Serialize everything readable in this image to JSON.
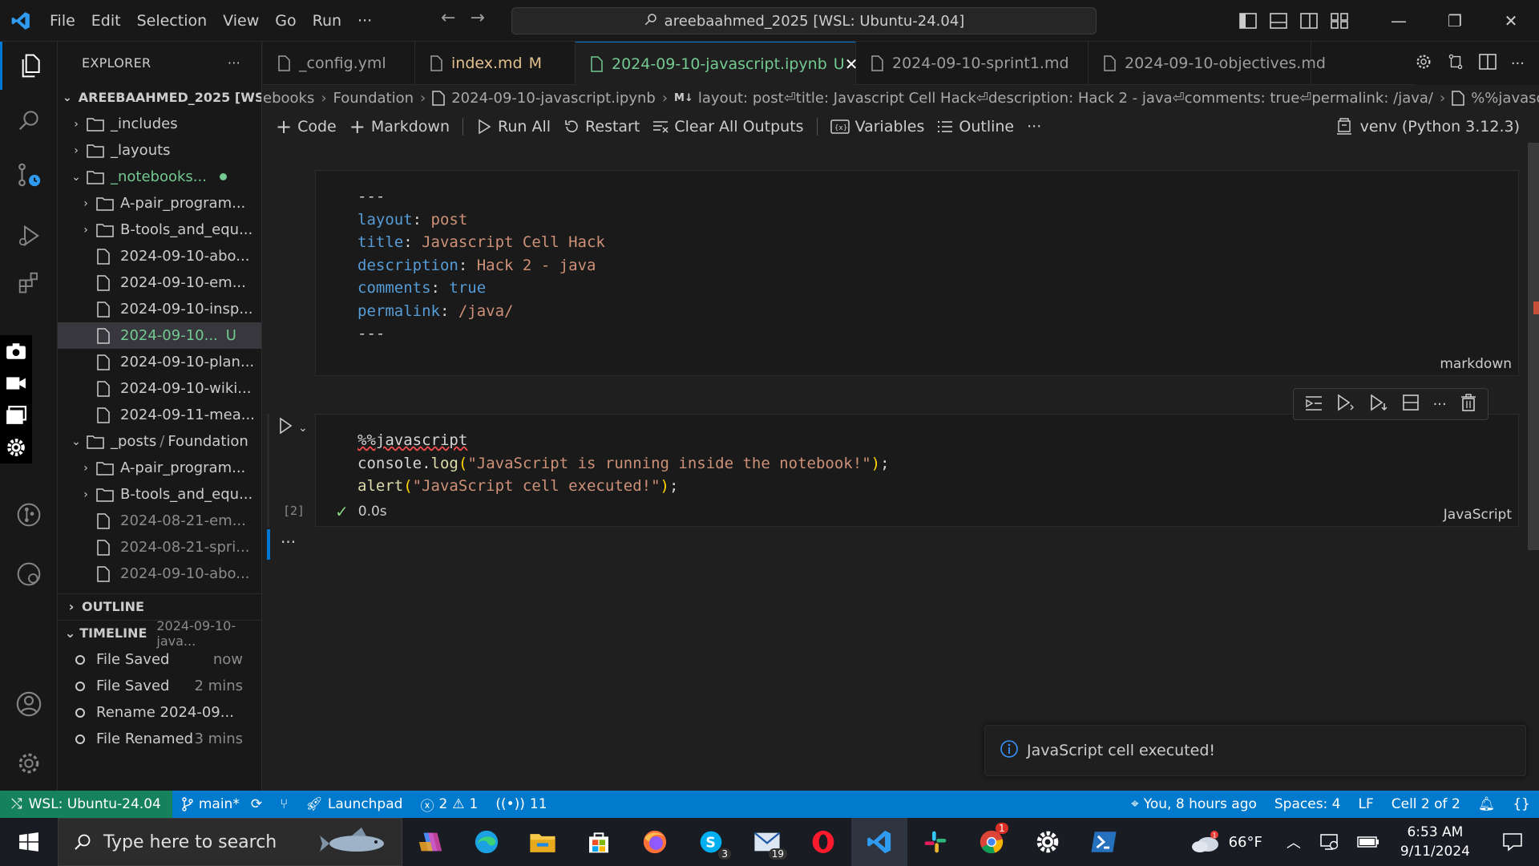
{
  "menu": [
    "File",
    "Edit",
    "Selection",
    "View",
    "Go",
    "Run",
    "···"
  ],
  "command_center": "areebaahmed_2025 [WSL: Ubuntu-24.04]",
  "explorer": {
    "title": "EXPLORER",
    "more": "···",
    "root": "AREEBAAHMED_2025 [WS...",
    "items": [
      {
        "label": "_includes",
        "type": "folder",
        "expanded": false
      },
      {
        "label": "_layouts",
        "type": "folder",
        "expanded": false
      },
      {
        "label": "_notebooks...",
        "type": "folder",
        "expanded": true
      },
      {
        "label": "A-pair_program...",
        "type": "folder",
        "expanded": false
      },
      {
        "label": "B-tools_and_equ...",
        "type": "folder",
        "expanded": false
      },
      {
        "label": "2024-09-10-abo...",
        "type": "file"
      },
      {
        "label": "2024-09-10-em...",
        "type": "file"
      },
      {
        "label": "2024-09-10-insp...",
        "type": "file"
      },
      {
        "label": "2024-09-10...",
        "type": "file",
        "badge": "U"
      },
      {
        "label": "2024-09-10-plan...",
        "type": "file"
      },
      {
        "label": "2024-09-10-wiki...",
        "type": "file"
      },
      {
        "label": "2024-09-11-mea...",
        "type": "file"
      },
      {
        "label": "_posts",
        "label2": "Foundation",
        "type": "folder",
        "expanded": true
      },
      {
        "label": "A-pair_program...",
        "type": "folder",
        "expanded": false
      },
      {
        "label": "B-tools_and_equ...",
        "type": "folder",
        "expanded": false
      },
      {
        "label": "2024-08-21-em...",
        "type": "file"
      },
      {
        "label": "2024-08-21-spri...",
        "type": "file"
      },
      {
        "label": "2024-09-10-abo...",
        "type": "file"
      }
    ]
  },
  "outline": {
    "title": "OUTLINE"
  },
  "timeline": {
    "title": "TIMELINE",
    "file": "2024-09-10-java...",
    "entries": [
      {
        "label": "File Saved",
        "when": "now"
      },
      {
        "label": "File Saved",
        "when": "2 mins"
      },
      {
        "label": "Rename 2024-09...",
        "when": ""
      },
      {
        "label": "File Renamed",
        "when": "3 mins"
      }
    ]
  },
  "tabs": [
    {
      "label": "_config.yml",
      "badge": ""
    },
    {
      "label": "index.md",
      "badge": "M"
    },
    {
      "label": "2024-09-10-javascript.ipynb",
      "badge": "U",
      "active": true
    },
    {
      "label": "2024-09-10-sprint1.md",
      "badge": ""
    },
    {
      "label": "2024-09-10-objectives.md",
      "badge": ""
    }
  ],
  "breadcrumb": {
    "parts": [
      "ebooks",
      "Foundation",
      "2024-09-10-javascript.ipynb"
    ],
    "md_badge": "M↓",
    "md_text": "layout: post⏎title: Javascript Cell Hack⏎description: Hack 2 - java⏎comments: true⏎permalink: /java/",
    "cell": "%%javascript"
  },
  "toolbar": {
    "code": "Code",
    "markdown": "Markdown",
    "run_all": "Run All",
    "restart": "Restart",
    "clear_outputs": "Clear All Outputs",
    "variables": "Variables",
    "outline": "Outline",
    "more": "···",
    "kernel": "venv (Python 3.12.3)"
  },
  "cell1": {
    "lang": "markdown",
    "lines": [
      [
        {
          "t": "---",
          "c": "t"
        }
      ],
      [
        {
          "t": "layout",
          "c": "k"
        },
        {
          "t": ": ",
          "c": "p"
        },
        {
          "t": "post",
          "c": "s"
        }
      ],
      [
        {
          "t": "title",
          "c": "k"
        },
        {
          "t": ": ",
          "c": "p"
        },
        {
          "t": "Javascript Cell Hack",
          "c": "s"
        }
      ],
      [
        {
          "t": "description",
          "c": "k"
        },
        {
          "t": ": ",
          "c": "p"
        },
        {
          "t": "Hack 2 - java",
          "c": "s"
        }
      ],
      [
        {
          "t": "comments",
          "c": "k"
        },
        {
          "t": ": ",
          "c": "p"
        },
        {
          "t": "true",
          "c": "b"
        }
      ],
      [
        {
          "t": "permalink",
          "c": "k"
        },
        {
          "t": ": ",
          "c": "p"
        },
        {
          "t": "/java/",
          "c": "s"
        }
      ],
      [
        {
          "t": "---",
          "c": "t"
        }
      ]
    ]
  },
  "cell2": {
    "lang": "JavaScript",
    "exec_count": "[2]",
    "duration": "0.0s",
    "lines": [
      [
        {
          "t": "%%javascript",
          "c": "t"
        }
      ],
      [
        {
          "t": "console",
          "c": "t"
        },
        {
          "t": ".",
          "c": "t"
        },
        {
          "t": "log",
          "c": "fn"
        },
        {
          "t": "(",
          "c": "y"
        },
        {
          "t": "\"JavaScript is running inside the notebook!\"",
          "c": "s"
        },
        {
          "t": ")",
          "c": "y"
        },
        {
          "t": ";",
          "c": "t"
        }
      ],
      [
        {
          "t": "alert",
          "c": "fn"
        },
        {
          "t": "(",
          "c": "y"
        },
        {
          "t": "\"JavaScript cell executed!\"",
          "c": "s"
        },
        {
          "t": ")",
          "c": "y"
        },
        {
          "t": ";",
          "c": "t"
        }
      ]
    ]
  },
  "output_more": "···",
  "notification": "JavaScript cell executed!",
  "status": {
    "remote": "WSL: Ubuntu-24.04",
    "branch": "main*",
    "launchpad": "Launchpad",
    "errors": "2",
    "warnings": "1",
    "ports": "11",
    "blame": "You, 8 hours ago",
    "spaces": "Spaces: 4",
    "eol": "LF",
    "cell": "Cell 2 of 2",
    "braces": "{}"
  },
  "taskbar": {
    "search_placeholder": "Type here to search",
    "skype_badge": "3",
    "mail_badge": "19",
    "opera_badge": "1",
    "temp": "66°F",
    "time": "6:53 AM",
    "date": "9/11/2024"
  },
  "colors": {
    "accent": "#0078d4",
    "statusbar": "#007acc",
    "remote": "#16825d",
    "untracked": "#73c991",
    "modified": "#e2c08d"
  }
}
